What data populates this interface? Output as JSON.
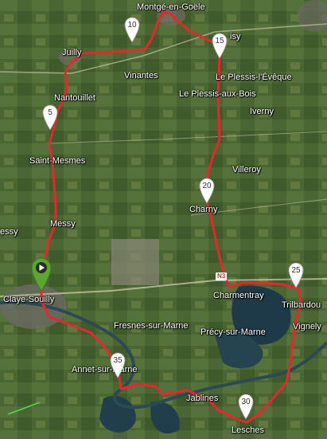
{
  "places": [
    {
      "id": "montge",
      "label": "Montgé-en-Goële"
    },
    {
      "id": "juilly",
      "label": "Juilly"
    },
    {
      "id": "vinantes",
      "label": "Vinantes"
    },
    {
      "id": "plessis-eveque",
      "label": "Le Plessis-l'Évêque"
    },
    {
      "id": "plessis-bois",
      "label": "Le Plessis-aux-Bois"
    },
    {
      "id": "nantouillet",
      "label": "Nantouillet"
    },
    {
      "id": "iverny",
      "label": "Iverny"
    },
    {
      "id": "saint-mesmes",
      "label": "Saint-Mesmes"
    },
    {
      "id": "villeroy",
      "label": "Villeroy"
    },
    {
      "id": "charny",
      "label": "Charny"
    },
    {
      "id": "messy",
      "label": "Messy"
    },
    {
      "id": "messy-left",
      "label": "essy"
    },
    {
      "id": "charmentray",
      "label": "Charmentray"
    },
    {
      "id": "trilbardou",
      "label": "Trilbardou"
    },
    {
      "id": "claye-souilly",
      "label": "Claye-Souilly"
    },
    {
      "id": "fresnes",
      "label": "Fresnes-sur-Marne"
    },
    {
      "id": "precy",
      "label": "Précy-sur-Marne"
    },
    {
      "id": "vignely",
      "label": "Vignely"
    },
    {
      "id": "annet",
      "label": "Annet-sur-Marne"
    },
    {
      "id": "jablines",
      "label": "Jablines"
    },
    {
      "id": "lesches",
      "label": "Lesches"
    },
    {
      "id": "isy",
      "label": "isy"
    }
  ],
  "distance_markers": [
    {
      "id": "km5",
      "label": "5"
    },
    {
      "id": "km10",
      "label": "10"
    },
    {
      "id": "km15",
      "label": "15"
    },
    {
      "id": "km20",
      "label": "20"
    },
    {
      "id": "km25",
      "label": "25"
    },
    {
      "id": "km30",
      "label": "30"
    },
    {
      "id": "km35",
      "label": "35"
    }
  ],
  "road_label": "N3",
  "colors": {
    "route": "#e8262c",
    "start_marker": "#5aa72e",
    "distance_marker": "#ffffff",
    "water": "#1e3a48",
    "road": "#d9d2b4"
  },
  "icons": {
    "start": "play-icon"
  }
}
